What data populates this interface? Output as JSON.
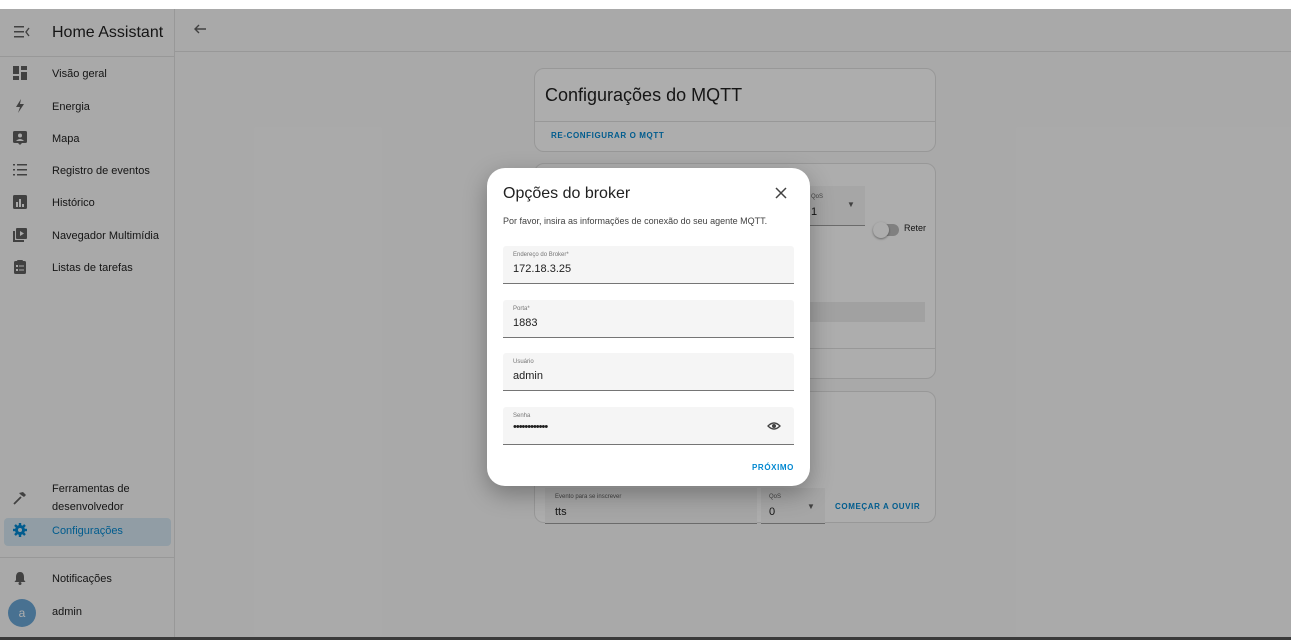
{
  "app": {
    "title": "Home Assistant",
    "user_initial": "a",
    "user_name": "admin"
  },
  "sidebar": {
    "items": [
      {
        "label": "Visão geral",
        "icon": "dashboard-icon"
      },
      {
        "label": "Energia",
        "icon": "lightning-bolt-icon"
      },
      {
        "label": "Mapa",
        "icon": "map-account-icon"
      },
      {
        "label": "Registro de eventos",
        "icon": "list-icon"
      },
      {
        "label": "Histórico",
        "icon": "chart-box-icon"
      },
      {
        "label": "Navegador Multimídia",
        "icon": "play-box-multiple-icon"
      },
      {
        "label": "Listas de tarefas",
        "icon": "clipboard-list-icon"
      }
    ],
    "developer_tools": "Ferramentas de desenvolvedor",
    "settings": "Configurações",
    "notifications": "Notificações"
  },
  "mqtt_card": {
    "title": "Configurações do MQTT",
    "reconfigure": "RE-CONFIGURAR O MQTT"
  },
  "publish_card": {
    "qos_label": "QoS",
    "qos_value": "1",
    "retain_label": "Reter"
  },
  "listen_card": {
    "event_label": "Evento para se inscrever",
    "event_value": "tts",
    "qos_label": "QoS",
    "qos_value": "0",
    "start_listening": "COMEÇAR A OUVIR"
  },
  "dialog": {
    "title": "Opções do broker",
    "description": "Por favor, insira as informações de conexão do seu agente MQTT.",
    "fields": {
      "broker": {
        "label": "Endereço do Broker*",
        "value": "172.18.3.25"
      },
      "port": {
        "label": "Porta*",
        "value": "1883"
      },
      "username": {
        "label": "Usuário",
        "value": "admin"
      },
      "password": {
        "label": "Senha",
        "value": "••••••••••••"
      }
    },
    "next": "PRÓXIMO"
  }
}
